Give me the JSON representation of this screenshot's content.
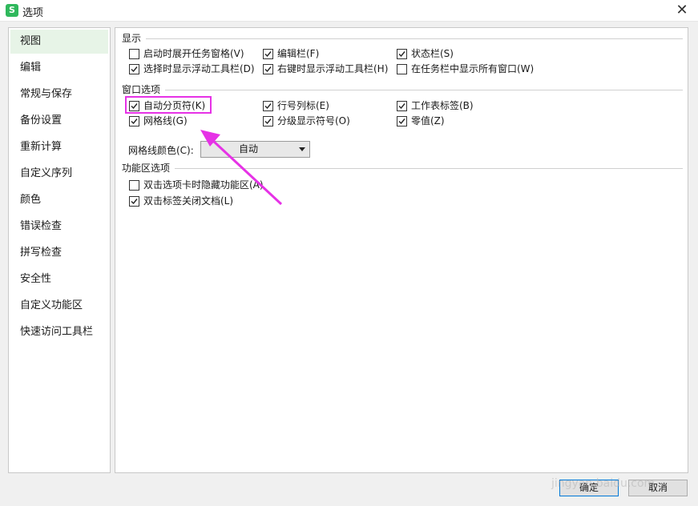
{
  "window": {
    "title": "选项",
    "logo_letter": "S",
    "close_glyph": "✕"
  },
  "sidebar": {
    "items": [
      {
        "label": "视图",
        "selected": true
      },
      {
        "label": "编辑"
      },
      {
        "label": "常规与保存"
      },
      {
        "label": "备份设置"
      },
      {
        "label": "重新计算"
      },
      {
        "label": "自定义序列"
      },
      {
        "label": "颜色"
      },
      {
        "label": "错误检查"
      },
      {
        "label": "拼写检查"
      },
      {
        "label": "安全性"
      },
      {
        "label": "自定义功能区"
      },
      {
        "label": "快速访问工具栏"
      }
    ]
  },
  "sections": {
    "display": {
      "title": "显示",
      "options": [
        {
          "label": "启动时展开任务窗格(V)",
          "checked": false
        },
        {
          "label": "编辑栏(F)",
          "checked": true
        },
        {
          "label": "状态栏(S)",
          "checked": true
        },
        {
          "label": "选择时显示浮动工具栏(D)",
          "checked": true
        },
        {
          "label": "右键时显示浮动工具栏(H)",
          "checked": true
        },
        {
          "label": "在任务栏中显示所有窗口(W)",
          "checked": false
        }
      ]
    },
    "window_options": {
      "title": "窗口选项",
      "options": [
        {
          "label": "自动分页符(K)",
          "checked": true
        },
        {
          "label": "行号列标(E)",
          "checked": true
        },
        {
          "label": "工作表标签(B)",
          "checked": true
        },
        {
          "label": "网格线(G)",
          "checked": true
        },
        {
          "label": "分级显示符号(O)",
          "checked": true
        },
        {
          "label": "零值(Z)",
          "checked": true
        }
      ],
      "gridline_color_label": "网格线颜色(C):",
      "gridline_color_value": "自动"
    },
    "ribbon": {
      "title": "功能区选项",
      "options": [
        {
          "label": "双击选项卡时隐藏功能区(A)",
          "checked": false
        },
        {
          "label": "双击标签关闭文档(L)",
          "checked": true
        }
      ]
    }
  },
  "buttons": {
    "ok": "确定",
    "cancel": "取消"
  },
  "watermark": "jingyan.baidu.com",
  "colors": {
    "highlight": "#e632e6",
    "selected_bg": "#e7f4e7",
    "logo": "#2fb85c"
  }
}
